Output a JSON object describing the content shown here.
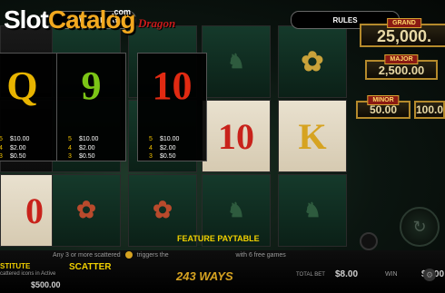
{
  "brand": {
    "slot": "Slot",
    "catalog": "Catalog",
    "com": ".com"
  },
  "top_bar": {
    "left_label": "HOW TO PLAY",
    "rules_label": "RULES"
  },
  "game_title": "Dragon",
  "jackpots": {
    "grand": {
      "label": "GRAND",
      "value": "25,000."
    },
    "major": {
      "label": "MAJOR",
      "value": "2,500.00"
    },
    "minor": {
      "label": "MINOR",
      "values": [
        "50.00",
        "100.00"
      ]
    }
  },
  "paytable": [
    {
      "symbol": "Q",
      "color": "#e8b400",
      "pays": [
        [
          "5",
          "$10.00"
        ],
        [
          "4",
          "$2.00"
        ],
        [
          "3",
          "$0.50"
        ]
      ]
    },
    {
      "symbol": "9",
      "color": "#7cc516",
      "pays": [
        [
          "5",
          "$10.00"
        ],
        [
          "4",
          "$2.00"
        ],
        [
          "3",
          "$0.50"
        ]
      ]
    },
    {
      "symbol": "10",
      "color": "#e12a12",
      "pays": [
        [
          "5",
          "$10.00"
        ],
        [
          "4",
          "$2.00"
        ],
        [
          "3",
          "$0.50"
        ]
      ]
    }
  ],
  "reel_symbols": {
    "r1": "10",
    "r2": "K",
    "r3": "0"
  },
  "feature": {
    "paytable_label": "FEATURE PAYTABLE",
    "description_left": "Any 3 or more scattered",
    "description_mid": "triggers the",
    "description_right": "with 6 free games",
    "substitute_label": "STITUTE",
    "substitute_sub": "cattered icons in Active",
    "scatter_label": "SCATTER"
  },
  "status": {
    "ways": "243 WAYS",
    "total_bet_label": "TOTAL BET",
    "total_bet": "$8.00",
    "win_label": "WIN",
    "win": "$0.00",
    "credit": "$500.00"
  },
  "colors": {
    "gold": "#f2c200",
    "accent": "#f2a81f"
  }
}
